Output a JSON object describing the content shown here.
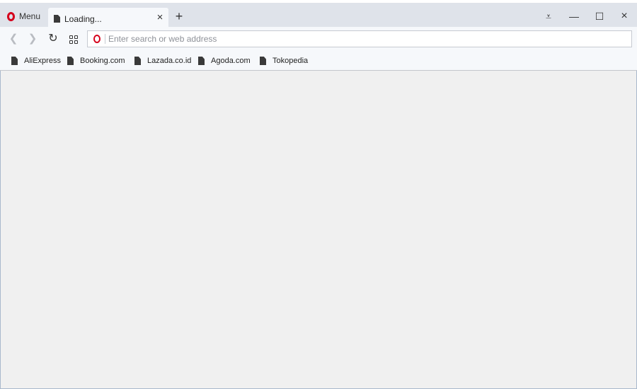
{
  "menu": {
    "label": "Menu"
  },
  "tab": {
    "title": "Loading...",
    "close_icon": "×"
  },
  "new_tab": {
    "icon": "+"
  },
  "window_controls": {
    "filter": "⩡",
    "minimize": "—",
    "maximize": "☐",
    "close": "×"
  },
  "nav": {
    "back": "❮",
    "forward": "❯",
    "reload": "↻"
  },
  "address": {
    "placeholder": "Enter search or web address",
    "value": ""
  },
  "bookmarks": [
    {
      "label": "AliExpress"
    },
    {
      "label": "Booking.com"
    },
    {
      "label": "Lazada.co.id"
    },
    {
      "label": "Agoda.com"
    },
    {
      "label": "Tokopedia"
    }
  ],
  "colors": {
    "opera_red": "#d5001c",
    "tabbar": "#dfe3ea",
    "toolbar": "#f6f8fb",
    "content": "#f0f0f0"
  }
}
